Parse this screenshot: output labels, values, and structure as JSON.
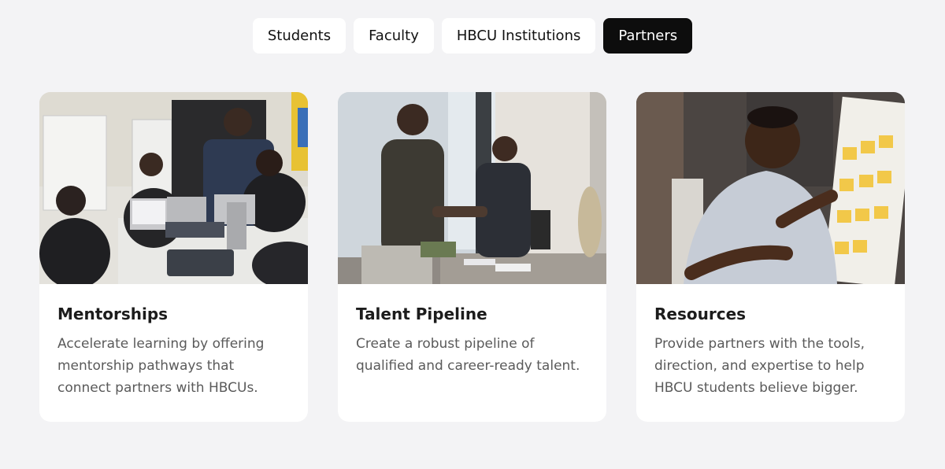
{
  "tabs": [
    {
      "label": "Students",
      "active": false
    },
    {
      "label": "Faculty",
      "active": false
    },
    {
      "label": "HBCU Institutions",
      "active": false
    },
    {
      "label": "Partners",
      "active": true
    }
  ],
  "cards": [
    {
      "title": "Mentorships",
      "text": "Accelerate learning by offering mentorship pathways that connect partners with HBCUs.",
      "image": "photo of a mentor standing over students working on laptops at a table"
    },
    {
      "title": "Talent Pipeline",
      "text": "Create a robust pipeline of qualified and career-ready talent.",
      "image": "photo of two men shaking hands in an office"
    },
    {
      "title": "Resources",
      "text": "Provide partners with the tools, direction, and expertise to help HBCU students believe bigger.",
      "image": "photo of a man placing sticky notes on a whiteboard"
    }
  ],
  "colors": {
    "page_bg": "#f3f3f5",
    "card_bg": "#ffffff",
    "active_tab_bg": "#0d0d0d",
    "title": "#1c1c1c",
    "body_text": "#5a5a5a"
  }
}
